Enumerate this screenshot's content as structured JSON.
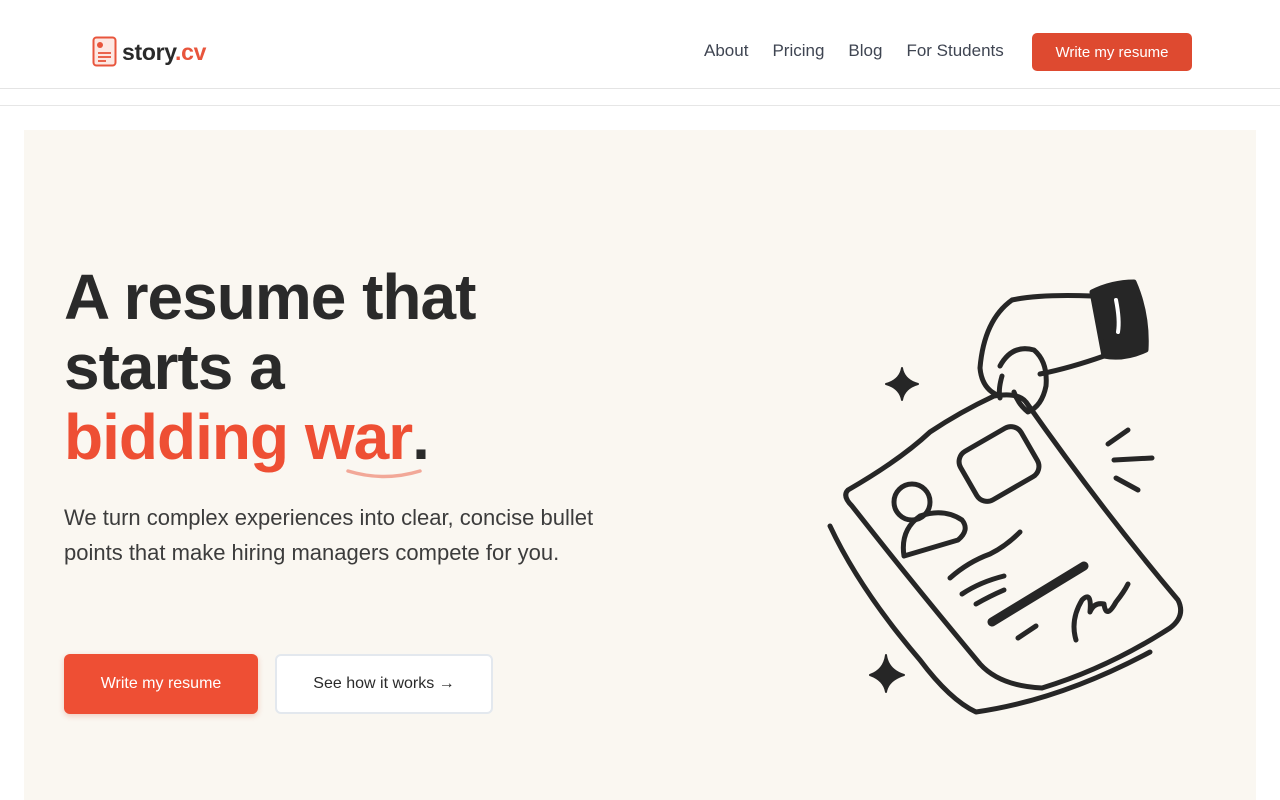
{
  "brand": {
    "name": "story",
    "tld": ".cv",
    "accent": "#ee4f34"
  },
  "nav": {
    "items": [
      {
        "label": "About"
      },
      {
        "label": "Pricing"
      },
      {
        "label": "Blog"
      },
      {
        "label": "For Students"
      }
    ],
    "cta_label": "Write my resume"
  },
  "hero": {
    "headline_line1": "A resume that",
    "headline_line2": "starts a",
    "headline_accent_1": "bidding ",
    "headline_accent_2": "war",
    "headline_period": ".",
    "subtext": "We turn complex experiences into clear, concise bullet points that make hiring managers compete for you.",
    "primary_button": "Write my resume",
    "secondary_button": "See how it works →"
  }
}
